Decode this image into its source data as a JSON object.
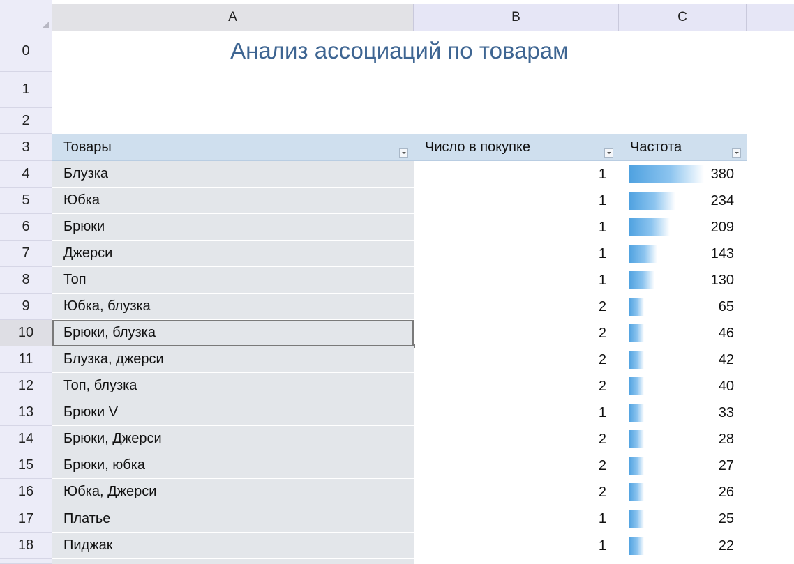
{
  "columns": [
    {
      "letter": "A"
    },
    {
      "letter": "B"
    },
    {
      "letter": "C"
    }
  ],
  "title": "Анализ ассоциаций по товарам",
  "table": {
    "headers": [
      "Товары",
      "Число в покупке",
      "Частота"
    ],
    "rows": [
      {
        "item": "Блузка",
        "count": "1",
        "freq": "380",
        "freq_value": 380
      },
      {
        "item": "Юбка",
        "count": "1",
        "freq": "234",
        "freq_value": 234
      },
      {
        "item": "Брюки",
        "count": "1",
        "freq": "209",
        "freq_value": 209
      },
      {
        "item": "Джерси",
        "count": "1",
        "freq": "143",
        "freq_value": 143
      },
      {
        "item": "Топ",
        "count": "1",
        "freq": "130",
        "freq_value": 130
      },
      {
        "item": "Юбка, блузка",
        "count": "2",
        "freq": "65",
        "freq_value": 65
      },
      {
        "item": "Брюки, блузка",
        "count": "2",
        "freq": "46",
        "freq_value": 46
      },
      {
        "item": "Блузка, джерси",
        "count": "2",
        "freq": "42",
        "freq_value": 42
      },
      {
        "item": "Топ, блузка",
        "count": "2",
        "freq": "40",
        "freq_value": 40
      },
      {
        "item": "Брюки V",
        "count": "1",
        "freq": "33",
        "freq_value": 33
      },
      {
        "item": "Брюки, Джерси",
        "count": "2",
        "freq": "28",
        "freq_value": 28
      },
      {
        "item": "Брюки, юбка",
        "count": "2",
        "freq": "27",
        "freq_value": 27
      },
      {
        "item": "Юбка, Джерси",
        "count": "2",
        "freq": "26",
        "freq_value": 26
      },
      {
        "item": "Платье",
        "count": "1",
        "freq": "25",
        "freq_value": 25
      },
      {
        "item": "Пиджак",
        "count": "1",
        "freq": "22",
        "freq_value": 22
      }
    ],
    "selected_row_index": 6,
    "databar_max": 380
  },
  "row_numbers": [
    "0",
    "1",
    "2",
    "3",
    "4",
    "5",
    "6",
    "7",
    "8",
    "9",
    "10",
    "11",
    "12",
    "13",
    "14",
    "15",
    "16",
    "17",
    "18"
  ],
  "colors": {
    "title": "#3e6592",
    "header_fill": "#cfdfee",
    "cell_fill": "#e3e6ea",
    "databar": "#4ea1e0"
  }
}
